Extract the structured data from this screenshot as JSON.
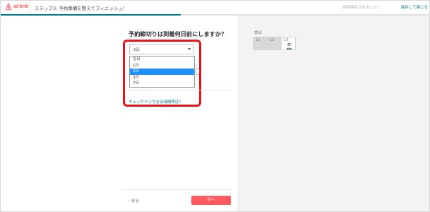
{
  "header": {
    "logo_text": "airbnb",
    "step_title": "ステップ3: 予約準備を整えてフィニッシュ！",
    "save_status": "前回保存されました・",
    "save_link": "保存して閉じる"
  },
  "progress": {
    "percent": 42
  },
  "main": {
    "question": "予約締切りは到着何日前にしますか？",
    "select": {
      "value": "2日"
    },
    "options": [
      "当日",
      "1日",
      "2日",
      "3日",
      "7日"
    ],
    "selected_index": 2,
    "checkin_link": "チェックインできる時間帯は？",
    "back_label": "‹ 戻る",
    "next_label": "次へ"
  },
  "calendar": {
    "month_label": "本日",
    "days": [
      "11",
      "12",
      "13"
    ]
  },
  "colors": {
    "brand": "#ff5a5f",
    "accent": "#007a87",
    "highlight": "#e8121b",
    "selected": "#1e90ff"
  }
}
